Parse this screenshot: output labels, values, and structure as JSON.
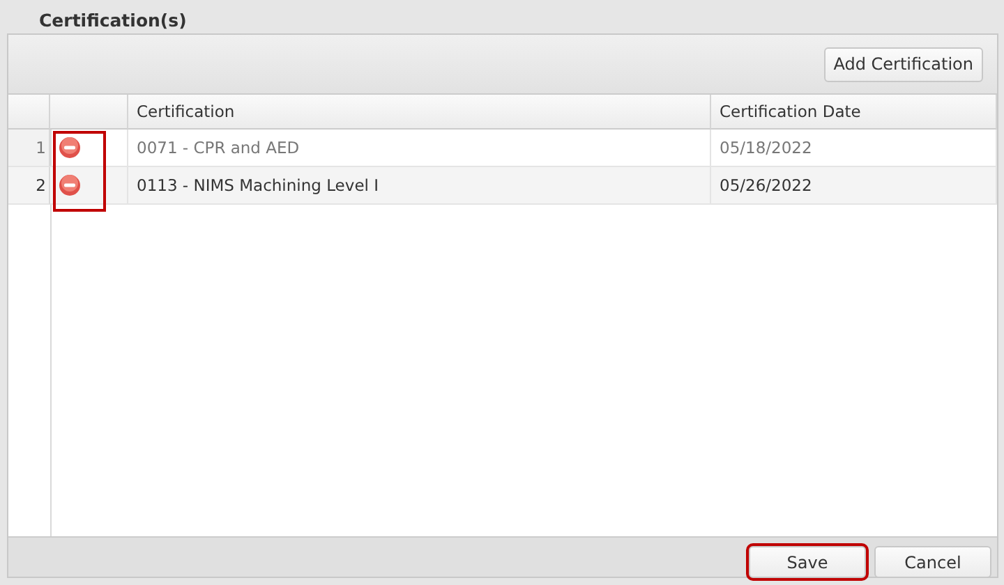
{
  "title": "Certification(s)",
  "toolbar": {
    "add_button": "Add Certification"
  },
  "table": {
    "columns": [
      "Certification",
      "Certification Date"
    ],
    "delete_column_highlighted": true,
    "rows": [
      {
        "number": "1",
        "certification": "0071 - CPR and AED",
        "date": "05/18/2022",
        "selected": false
      },
      {
        "number": "2",
        "certification": "0113 - NIMS Machining Level I",
        "date": "05/26/2022",
        "selected": true
      }
    ]
  },
  "buttons": [
    {
      "label": "Save",
      "highlighted": true
    },
    {
      "label": "Cancel",
      "highlighted": false
    }
  ]
}
